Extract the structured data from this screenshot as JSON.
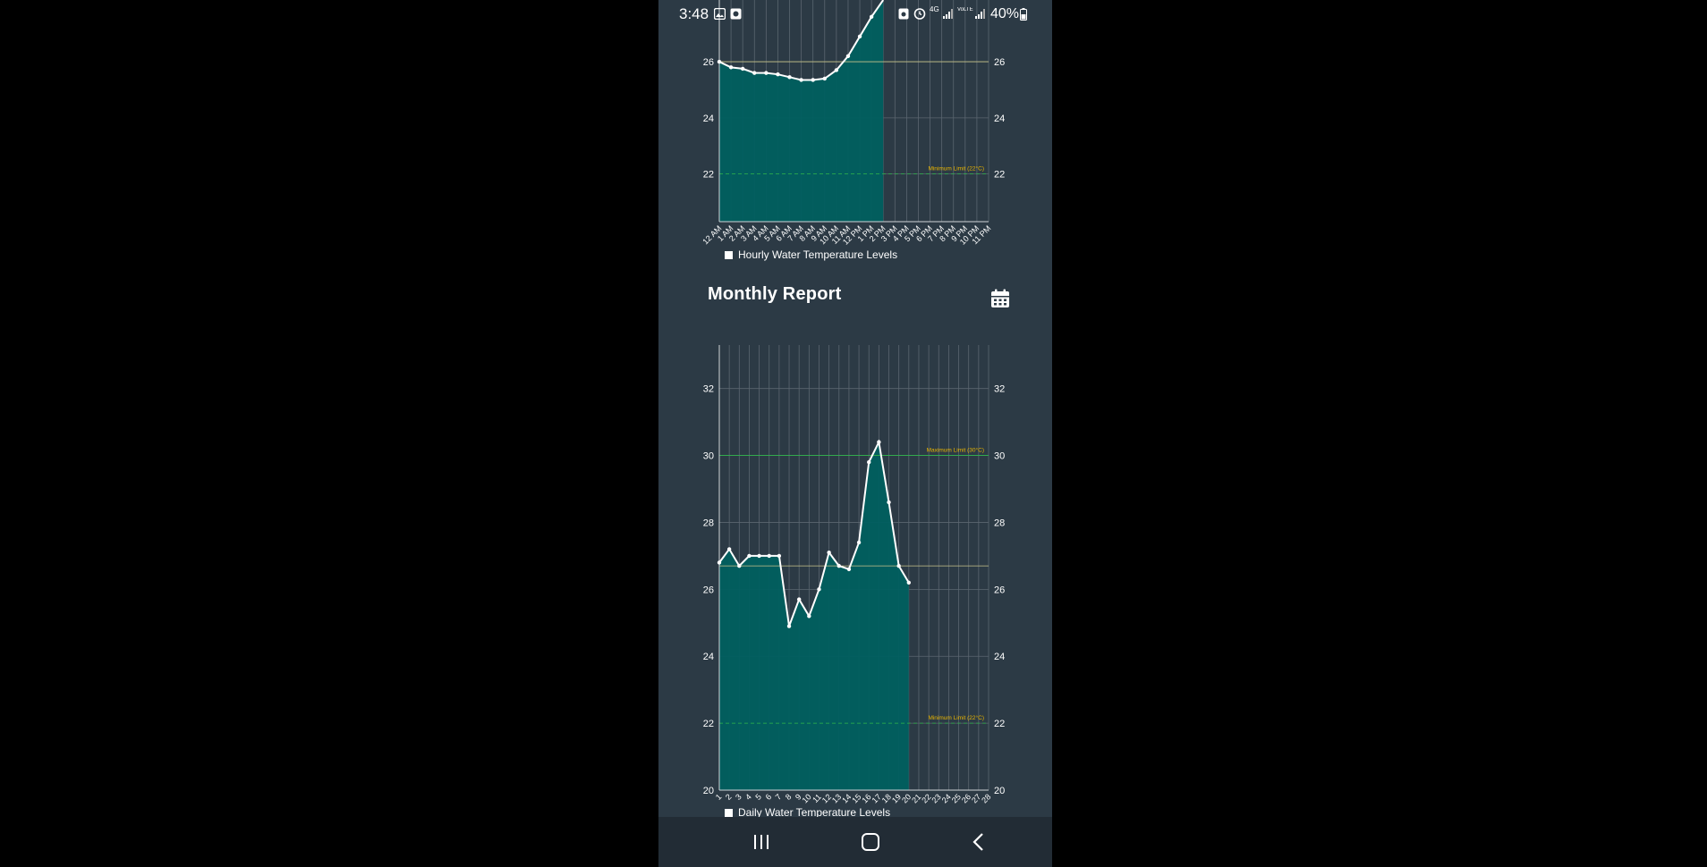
{
  "status_bar": {
    "time": "3:48",
    "network": "4G",
    "volte": "VoLTE",
    "battery": "40%"
  },
  "nav_bar": {
    "icons": [
      "recents-icon",
      "home-icon",
      "back-icon"
    ]
  },
  "monthly_report": {
    "title": "Monthly Report",
    "icon": "calendar-icon"
  },
  "colors": {
    "background": "#2c3a45",
    "area_fill": "#005f5f",
    "line": "#ffffff",
    "grid": "#5b6670",
    "threshold": "#e8b400",
    "threshold_line": "#2fb64a"
  },
  "chart_data": [
    {
      "type": "area",
      "title": "",
      "legend": "Hourly Water Temperature Levels",
      "legend_position": "bottom-left",
      "x": [
        "12 AM",
        "1 AM",
        "2 AM",
        "3 AM",
        "4 AM",
        "5 AM",
        "6 AM",
        "7 AM",
        "8 AM",
        "9 AM",
        "10 AM",
        "11 AM",
        "12 PM",
        "1 PM",
        "2 PM",
        "3 PM",
        "4 PM",
        "5 PM",
        "6 PM",
        "7 PM",
        "8 PM",
        "9 PM",
        "10 PM",
        "11 PM"
      ],
      "values": [
        26.0,
        25.8,
        25.75,
        25.6,
        25.6,
        25.55,
        25.45,
        25.35,
        25.35,
        25.4,
        25.7,
        26.2,
        26.9,
        27.6,
        28.2,
        null,
        null,
        null,
        null,
        null,
        null,
        null,
        null,
        null
      ],
      "y_ticks": [
        22,
        24,
        26
      ],
      "ylim": [
        20.3,
        28.2
      ],
      "grid": true,
      "axis_right": true,
      "annotations": [
        {
          "label": "Minimum Limit (22°C)",
          "value": 22
        }
      ],
      "reference_line": 26
    },
    {
      "type": "area",
      "title": "",
      "legend": "Daily Water Temperature Levels",
      "legend_position": "bottom-left",
      "x": [
        "1",
        "2",
        "3",
        "4",
        "5",
        "6",
        "7",
        "8",
        "9",
        "10",
        "11",
        "12",
        "13",
        "14",
        "15",
        "16",
        "17",
        "18",
        "19",
        "20",
        "21",
        "22",
        "23",
        "24",
        "25",
        "26",
        "27",
        "28"
      ],
      "values": [
        26.8,
        27.2,
        26.7,
        27.0,
        27.0,
        27.0,
        27.0,
        24.9,
        25.7,
        25.2,
        26.0,
        27.1,
        26.7,
        26.6,
        27.4,
        29.8,
        30.4,
        28.6,
        26.7,
        26.2,
        null,
        null,
        null,
        null,
        null,
        null,
        null,
        null
      ],
      "y_ticks": [
        20,
        22,
        24,
        26,
        28,
        30,
        32
      ],
      "ylim": [
        20,
        33.3
      ],
      "grid": true,
      "axis_right": true,
      "annotations": [
        {
          "label": "Maximum Limit (30°C)",
          "value": 30
        },
        {
          "label": "Minimum Limit (22°C)",
          "value": 22
        }
      ],
      "reference_line": 26.7
    }
  ]
}
